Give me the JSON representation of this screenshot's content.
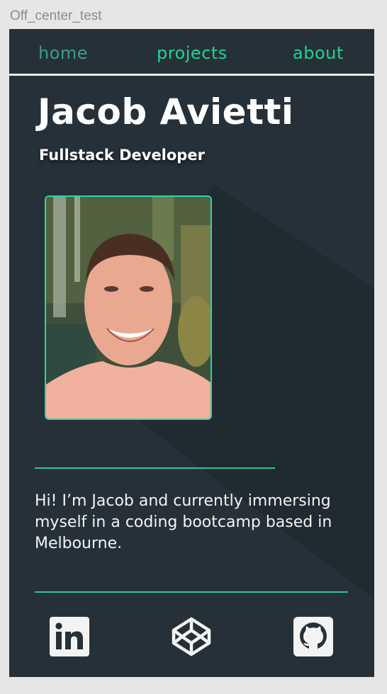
{
  "frame": {
    "label": "Off_center_test"
  },
  "nav": {
    "home": "home",
    "projects": "projects",
    "about": "about"
  },
  "hero": {
    "name": "Jacob Avietti",
    "role": "Fullstack Developer",
    "photo_alt": "Portrait photo of Jacob Avietti"
  },
  "bio": {
    "text": "Hi! I’m Jacob and currently immersing myself in a coding bootcamp based in Melbourne."
  },
  "social": [
    {
      "icon": "linkedin-icon"
    },
    {
      "icon": "codepen-icon"
    },
    {
      "icon": "github-icon"
    }
  ],
  "colors": {
    "background": "#253038",
    "accent": "#1fd494",
    "text": "#ffffff",
    "nav_active": "#3e9c8c"
  }
}
